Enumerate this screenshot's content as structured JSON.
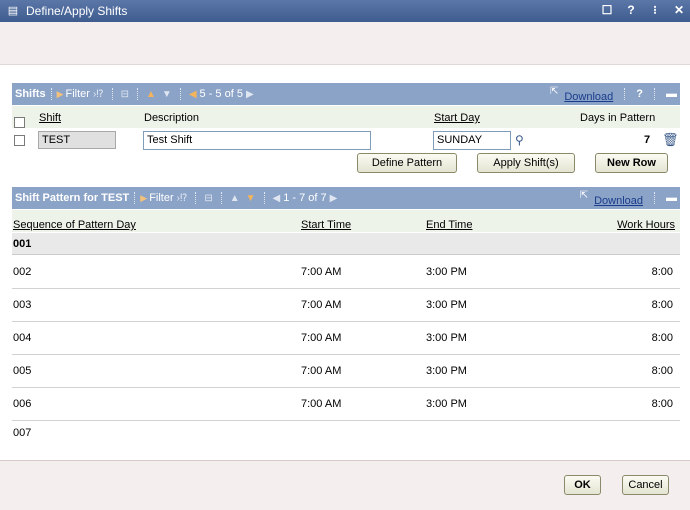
{
  "window": {
    "title": "Define/Apply Shifts",
    "controls": [
      "☐",
      "?",
      "⁝",
      "✕"
    ]
  },
  "shifts_grid": {
    "title": "Shifts",
    "filter_label": "Filter",
    "pager": "5 - 5 of 5",
    "download_label": "Download",
    "help": "?",
    "columns": {
      "shift": "Shift",
      "description": "Description",
      "start_day": "Start Day",
      "days_in_pattern": "Days in Pattern"
    },
    "row": {
      "shift": "TEST",
      "description": "Test Shift",
      "start_day": "SUNDAY",
      "days_in_pattern": "7"
    },
    "buttons": {
      "define_pattern": "Define Pattern",
      "apply_shifts": "Apply Shift(s)",
      "new_row": "New Row"
    }
  },
  "pattern_grid": {
    "title": "Shift Pattern for TEST",
    "filter_label": "Filter",
    "pager": "1 - 7 of 7",
    "download_label": "Download",
    "columns": {
      "sequence": "Sequence of Pattern Day",
      "start_time": "Start Time",
      "end_time": "End Time",
      "work_hours": "Work Hours"
    },
    "rows": [
      {
        "seq": "001",
        "start": "",
        "end": "",
        "hours": ""
      },
      {
        "seq": "002",
        "start": "7:00 AM",
        "end": "3:00 PM",
        "hours": "8:00"
      },
      {
        "seq": "003",
        "start": "7:00 AM",
        "end": "3:00 PM",
        "hours": "8:00"
      },
      {
        "seq": "004",
        "start": "7:00 AM",
        "end": "3:00 PM",
        "hours": "8:00"
      },
      {
        "seq": "005",
        "start": "7:00 AM",
        "end": "3:00 PM",
        "hours": "8:00"
      },
      {
        "seq": "006",
        "start": "7:00 AM",
        "end": "3:00 PM",
        "hours": "8:00"
      },
      {
        "seq": "007",
        "start": "",
        "end": "",
        "hours": ""
      }
    ]
  },
  "footer": {
    "ok": "OK",
    "cancel": "Cancel"
  }
}
